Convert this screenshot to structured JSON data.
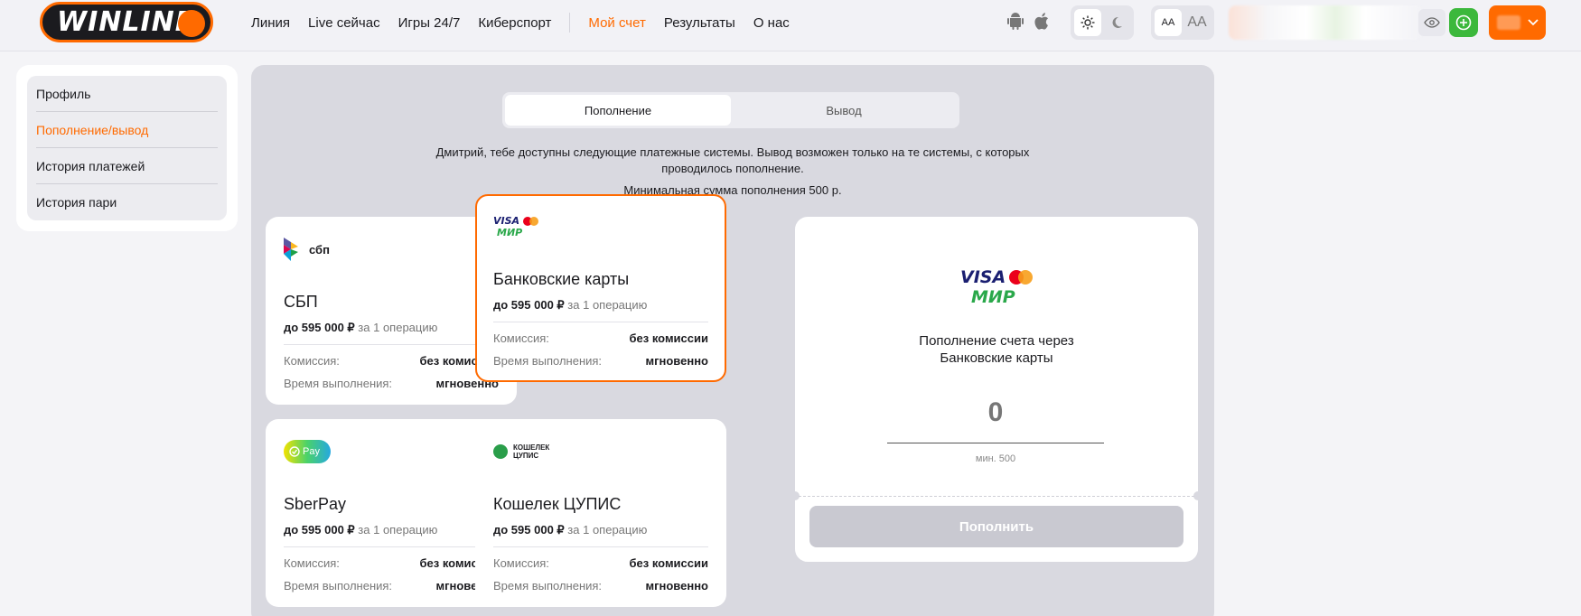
{
  "header": {
    "logo_text": "WINLINE",
    "nav": [
      "Линия",
      "Live сейчас",
      "Игры 24/7",
      "Киберспорт"
    ],
    "nav_secondary": [
      "Мой счет",
      "Результаты",
      "О нас"
    ],
    "font_small": "AA",
    "font_big": "AA"
  },
  "sidebar": {
    "items": [
      "Профиль",
      "Пополнение/вывод",
      "История платежей",
      "История пари"
    ]
  },
  "tabs": [
    "Пополнение",
    "Вывод"
  ],
  "info_text": "Дмитрий, тебе доступны следующие платежные системы. Вывод возможен только на те системы, с которых проводилось пополнение.",
  "min_note": "Минимальная сумма пополнения 500 р.",
  "cards": [
    {
      "title": "СБП",
      "limit_amount": "до 595 000 ₽",
      "limit_suffix": " за 1 операцию",
      "fee_label": "Комиссия:",
      "fee_value": "без комиссии",
      "time_label": "Время выполнения:",
      "time_value": "мгновенно",
      "logo_text": "сбп"
    },
    {
      "title": "Банковские карты",
      "limit_amount": "до 595 000 ₽",
      "limit_suffix": " за 1 операцию",
      "fee_label": "Комиссия:",
      "fee_value": "без комиссии",
      "time_label": "Время выполнения:",
      "time_value": "мгновенно",
      "logo_visa": "VISA",
      "logo_mir": "МИР"
    },
    {
      "title": "SberPay",
      "limit_amount": "до 595 000 ₽",
      "limit_suffix": " за 1 операцию",
      "fee_label": "Комиссия:",
      "fee_value": "без комиссии",
      "time_label": "Время выполнения:",
      "time_value": "мгновенно",
      "logo_text": "Pay"
    },
    {
      "title": "Кошелек ЦУПИС",
      "limit_amount": "до 595 000 ₽",
      "limit_suffix": " за 1 операцию",
      "fee_label": "Комиссия:",
      "fee_value": "без комиссии",
      "time_label": "Время выполнения:",
      "time_value": "мгновенно",
      "logo_line1": "КОШЕЛЕК",
      "logo_line2": "ЦУПИС"
    }
  ],
  "deposit_panel": {
    "logo_visa": "VISA",
    "logo_mir": "МИР",
    "title_line1": "Пополнение счета через",
    "title_line2": "Банковские карты",
    "amount": "0",
    "min_label": "мин. 500",
    "submit_label": "Пополнить"
  },
  "colors": {
    "accent": "#ff6a00",
    "green": "#3cb83c"
  }
}
